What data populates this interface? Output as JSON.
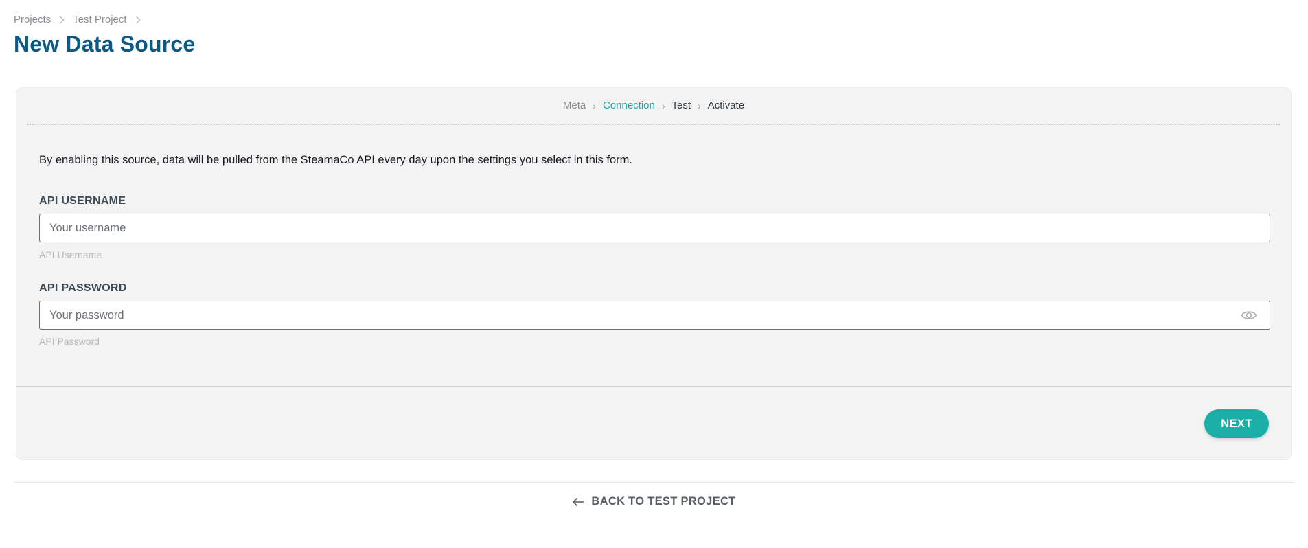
{
  "breadcrumb": {
    "items": [
      "Projects",
      "Test Project"
    ]
  },
  "page": {
    "title": "New Data Source"
  },
  "stepper": {
    "steps": [
      {
        "label": "Meta",
        "state": "done"
      },
      {
        "label": "Connection",
        "state": "active"
      },
      {
        "label": "Test",
        "state": "pending"
      },
      {
        "label": "Activate",
        "state": "pending"
      }
    ]
  },
  "form": {
    "intro": "By enabling this source, data will be pulled from the SteamaCo API every day upon the settings you select in this form.",
    "username": {
      "label": "API USERNAME",
      "placeholder": "Your username",
      "value": "",
      "help": "API Username"
    },
    "password": {
      "label": "API PASSWORD",
      "placeholder": "Your password",
      "value": "",
      "help": "API Password",
      "toggle_icon": "eye-icon"
    },
    "next_label": "NEXT"
  },
  "back": {
    "label": "BACK TO TEST PROJECT",
    "icon": "arrow-left-icon"
  },
  "colors": {
    "title": "#0b5a86",
    "accent": "#1aaea6",
    "active_step": "#17a9a4",
    "card_bg": "#f3f3f3"
  }
}
